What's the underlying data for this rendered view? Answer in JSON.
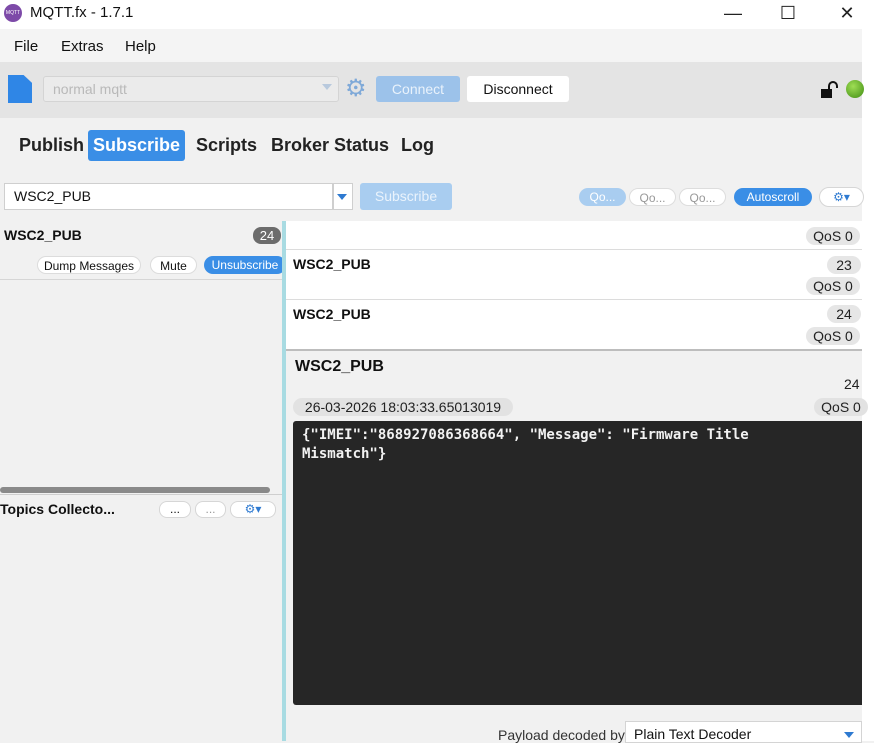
{
  "window": {
    "title": "MQTT.fx - 1.7.1",
    "icon_text": "MQTT",
    "minimize": "—",
    "maximize": "☐",
    "close": "✕"
  },
  "menu": [
    "File",
    "Extras",
    "Help"
  ],
  "toolbar": {
    "profile": "normal mqtt",
    "connect_label": "Connect",
    "disconnect_label": "Disconnect"
  },
  "tabs": [
    "Publish",
    "Subscribe",
    "Scripts",
    "Broker Status",
    "Log"
  ],
  "active_tab": "Subscribe",
  "subscribe_bar": {
    "topic": "WSC2_PUB",
    "subscribe_label": "Subscribe",
    "qos": [
      "Qo...",
      "Qo...",
      "Qo..."
    ],
    "autoscroll_label": "Autoscroll",
    "settings_glyph": "⚙▾"
  },
  "subscriptions": {
    "topic": "WSC2_PUB",
    "count": "24",
    "dump_label": "Dump Messages",
    "mute_label": "Mute",
    "unsubscribe_label": "Unsubscribe"
  },
  "topics_collector": {
    "title": "Topics Collecto...",
    "btn1": "...",
    "btn2": "...",
    "settings_glyph": "⚙▾"
  },
  "messages": [
    {
      "topic": "WSC2_PUB",
      "num": "23",
      "qos": "QoS 0"
    },
    {
      "topic": "WSC2_PUB",
      "num": "24",
      "qos": "QoS 0"
    }
  ],
  "partial_message": {
    "qos": "QoS 0"
  },
  "detail": {
    "topic": "WSC2_PUB",
    "num": "24",
    "timestamp": "26-03-2026  18:03:33.65013019",
    "qos": "QoS 0",
    "payload": "{\"IMEI\":\"868927086368664\", \"Message\": \"Firmware Title\nMismatch\"}"
  },
  "decoder": {
    "label": "Payload decoded by",
    "value": "Plain Text Decoder"
  },
  "colors": {
    "accent": "#3a8ee6",
    "payload_bg": "#262626",
    "splitter": "#a8dbe2"
  }
}
